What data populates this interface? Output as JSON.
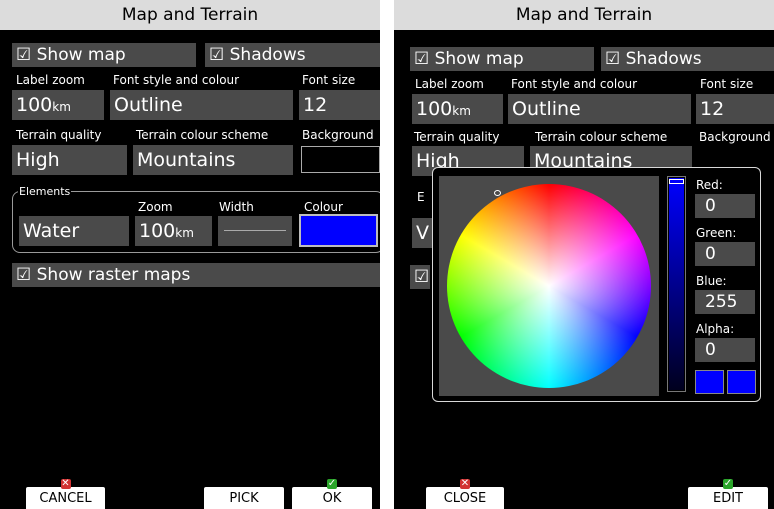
{
  "colors": {
    "selected_colour": "#0000ff",
    "water_colour": "#0000ff"
  },
  "left": {
    "title": "Map and Terrain",
    "show_map": "☑ Show map",
    "shadows": "☑ Shadows",
    "label_zoom_label": "Label zoom",
    "label_zoom_value": "100",
    "label_zoom_unit": "km",
    "font_style_label": "Font style and colour",
    "font_style_value": "Outline",
    "font_size_label": "Font size",
    "font_size_value": "12",
    "terrain_quality_label": "Terrain quality",
    "terrain_quality_value": "High",
    "terrain_scheme_label": "Terrain colour scheme",
    "terrain_scheme_value": "Mountains",
    "background_label": "Background",
    "elements_label": "Elements",
    "zoom_label": "Zoom",
    "width_label": "Width",
    "colour_label": "Colour",
    "element_value": "Water",
    "zoom_value": "100",
    "zoom_unit": "km",
    "show_raster": "☑ Show raster maps",
    "cancel": "CANCEL",
    "pick": "PICK",
    "ok": "OK"
  },
  "right": {
    "title": "Map and Terrain",
    "show_map": "☑ Show map",
    "shadows": "☑ Shadows",
    "label_zoom_label": "Label zoom",
    "label_zoom_value": "100",
    "label_zoom_unit": "km",
    "font_style_label": "Font style and colour",
    "font_style_value": "Outline",
    "font_size_label": "Font size",
    "font_size_value": "12",
    "terrain_quality_label": "Terrain quality",
    "terrain_quality_value": "High",
    "terrain_scheme_label": "Terrain colour scheme",
    "terrain_scheme_value": "Mountains",
    "background_label": "Background",
    "elements_initial": "E",
    "element_initial": "V",
    "raster_initial": "☑",
    "close": "CLOSE",
    "edit": "EDIT"
  },
  "picker": {
    "red_label": "Red:",
    "red": "0",
    "green_label": "Green:",
    "green": "0",
    "blue_label": "Blue:",
    "blue": "255",
    "alpha_label": "Alpha:",
    "alpha": "0"
  },
  "icons": {
    "cancel_mark": "x-icon",
    "ok_mark": "check-icon"
  }
}
